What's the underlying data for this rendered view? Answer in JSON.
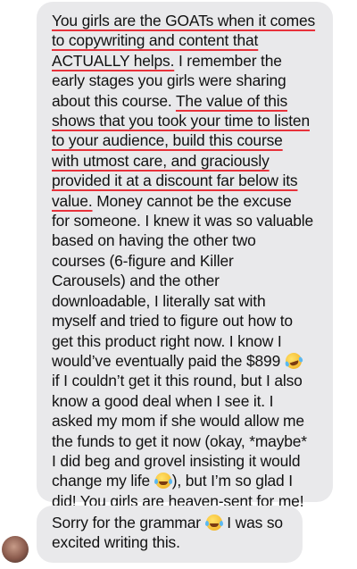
{
  "conversation": {
    "messages": [
      {
        "lines": [
          [
            {
              "t": "You girls are the GOATs when it comes",
              "u": true
            }
          ],
          [
            {
              "t": "to copywriting and content that",
              "u": true
            }
          ],
          [
            {
              "t": "ACTUALLY helps.",
              "u": true
            },
            {
              "t": " I remember the"
            }
          ],
          [
            {
              "t": "early stages you girls were sharing"
            }
          ],
          [
            {
              "t": "about this course. "
            },
            {
              "t": "The value of this",
              "u": true
            }
          ],
          [
            {
              "t": "shows that you took your time to listen",
              "u": true
            }
          ],
          [
            {
              "t": "to your audience, build this course",
              "u": true
            }
          ],
          [
            {
              "t": "with utmost care, and graciously",
              "u": true
            }
          ],
          [
            {
              "t": "provided it at a discount far below its",
              "u": true
            }
          ],
          [
            {
              "t": "value.",
              "u": true
            },
            {
              "t": " Money cannot be the excuse"
            }
          ],
          [
            {
              "t": "for someone. I knew it was so valuable"
            }
          ],
          [
            {
              "t": "based on having the other two"
            }
          ],
          [
            {
              "t": "courses (6-figure and Killer"
            }
          ],
          [
            {
              "t": "Carousels) and the other"
            }
          ],
          [
            {
              "t": "downloadable, I literally sat with"
            }
          ],
          [
            {
              "t": "myself and tried to figure out how to"
            }
          ],
          [
            {
              "t": "get this product right now. I know I"
            }
          ],
          [
            {
              "t": "would’ve eventually paid the $899 "
            },
            {
              "emoji": "rofl-emoji"
            }
          ],
          [
            {
              "t": "if I couldn’t get it this round, but I also"
            }
          ],
          [
            {
              "t": "know a good deal when I see it. I"
            }
          ],
          [
            {
              "t": "asked my mom if she would allow me"
            }
          ],
          [
            {
              "t": "the funds to get it now (okay, *maybe*"
            }
          ],
          [
            {
              "t": "I did beg and grovel insisting it would"
            }
          ],
          [
            {
              "t": "change my life "
            },
            {
              "emoji": "joy-emoji"
            },
            {
              "t": "), but I’m so glad I"
            }
          ],
          [
            {
              "t": "did! You girls are heaven-sent for me!"
            }
          ]
        ]
      },
      {
        "lines": [
          [
            {
              "t": "Sorry for the grammar "
            },
            {
              "emoji": "joy-emoji"
            },
            {
              "t": " I was so"
            }
          ],
          [
            {
              "t": "excited writing this."
            }
          ]
        ]
      }
    ]
  },
  "colors": {
    "bubble": "#e9e9eb",
    "underline": "#e8313a",
    "text": "#111111"
  }
}
